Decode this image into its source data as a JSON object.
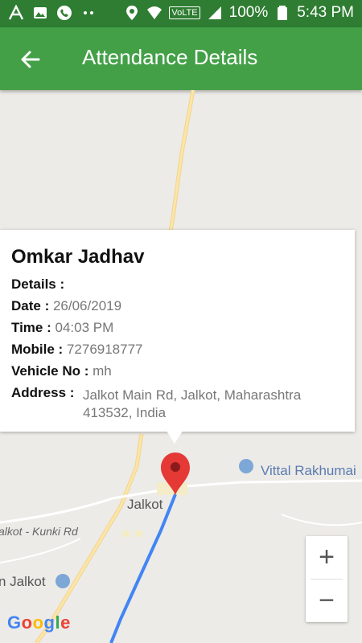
{
  "status_bar": {
    "battery": "100%",
    "time": "5:43 PM",
    "network_badge": "VoLTE"
  },
  "app_bar": {
    "title": "Attendance Details"
  },
  "info_window": {
    "name": "Omkar Jadhav",
    "details_label": "Details :",
    "date_label": "Date :",
    "date_value": "26/06/2019",
    "time_label": "Time :",
    "time_value": "04:03 PM",
    "mobile_label": "Mobile :",
    "mobile_value": "7276918777",
    "vehicle_label": "Vehicle No :",
    "vehicle_value": "mh",
    "address_label": "Address :",
    "address_value": "Jalkot Main Rd, Jalkot, Maharashtra 413532, India"
  },
  "map": {
    "place_jalkot": "Jalkot",
    "place_vittal": "Vittal Rakhumai",
    "road_label": "alkot - Kunki Rd",
    "place_jalkot_left": "n Jalkot",
    "zoom_in": "+",
    "zoom_out": "−",
    "google_logo": "Google",
    "route_color": "#4285f4",
    "marker_color": "#e53935"
  }
}
